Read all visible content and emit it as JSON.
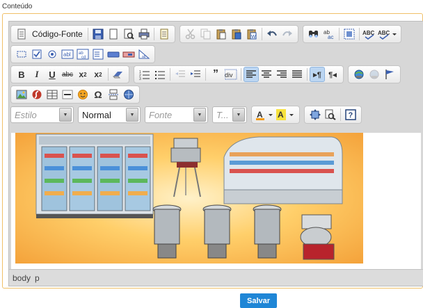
{
  "section_label": "Conteúdo",
  "toolbar": {
    "source_label": "Código-Fonte",
    "format_value": "Normal",
    "style_placeholder": "Estilo",
    "font_placeholder": "Fonte",
    "size_placeholder": "T..."
  },
  "statusbar": {
    "path": [
      "body",
      "p"
    ]
  },
  "save_label": "Salvar",
  "colors": {
    "frame_border": "#f0c068",
    "save_button": "#1f86d6",
    "active_button": "#bcd6f2"
  }
}
